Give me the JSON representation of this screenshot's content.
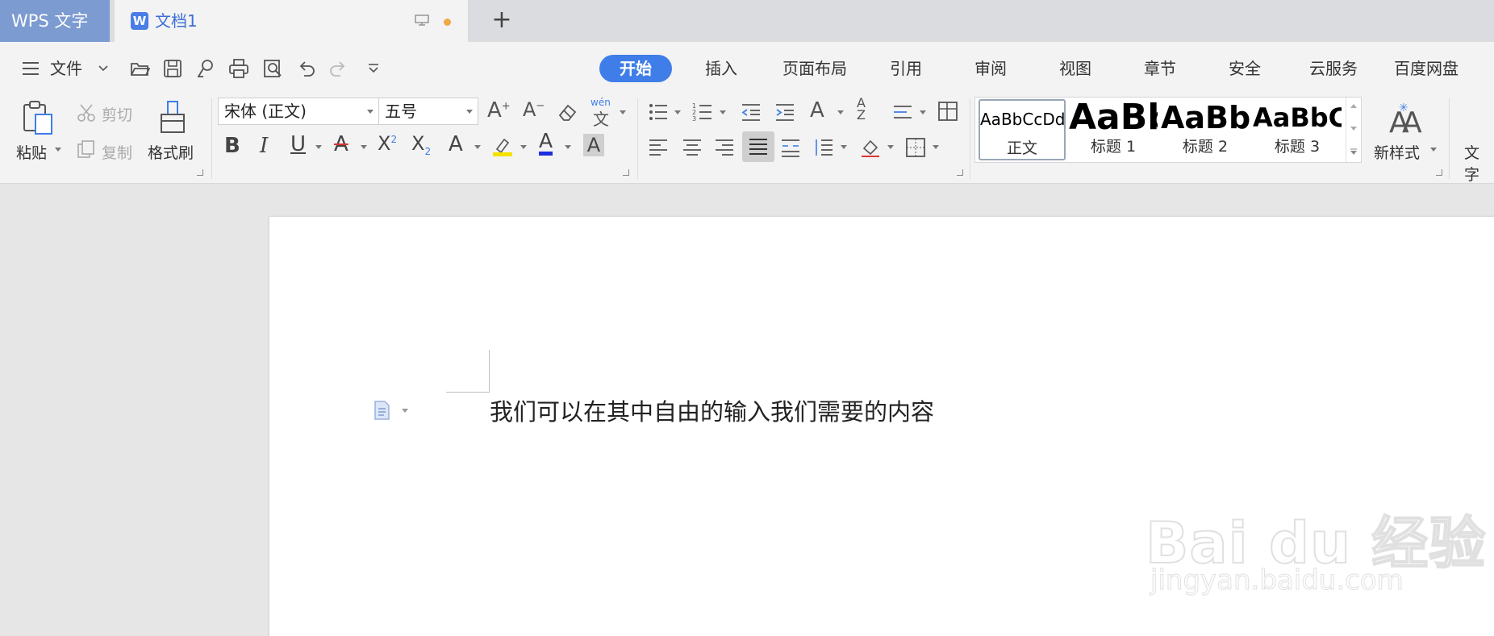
{
  "titlebar": {
    "app_name": "WPS 文字",
    "doc_tab_label": "文档1",
    "new_tab_label": "+"
  },
  "menubar": {
    "file_label": "文件",
    "tabs": [
      {
        "label": "开始",
        "active": true
      },
      {
        "label": "插入"
      },
      {
        "label": "页面布局"
      },
      {
        "label": "引用"
      },
      {
        "label": "审阅"
      },
      {
        "label": "视图"
      },
      {
        "label": "章节"
      },
      {
        "label": "安全"
      },
      {
        "label": "云服务"
      },
      {
        "label": "百度网盘"
      }
    ]
  },
  "ribbon": {
    "paste_label": "粘贴",
    "cut_label": "剪切",
    "copy_label": "复制",
    "format_painter_label": "格式刷",
    "font_name": "宋体 (正文)",
    "font_size": "五号",
    "phonetic_label": "wén",
    "styles": [
      {
        "sample": "AaBbCcDd",
        "name": "正文"
      },
      {
        "sample": "AaBb",
        "name": "标题 1"
      },
      {
        "sample": "AaBbC",
        "name": "标题 2"
      },
      {
        "sample": "AaBbCc",
        "name": "标题 3"
      }
    ],
    "new_style_label": "新样式",
    "text_tool_label": "文字"
  },
  "document": {
    "body_text": "我们可以在其中自由的输入我们需要的内容"
  },
  "watermark": {
    "brand": "Bai du 经验",
    "url": "jingyan.baidu.com"
  },
  "colors": {
    "accent": "#3f7ee8",
    "app_tab": "#7c9bd1",
    "unsaved_dot": "#f0a848"
  }
}
